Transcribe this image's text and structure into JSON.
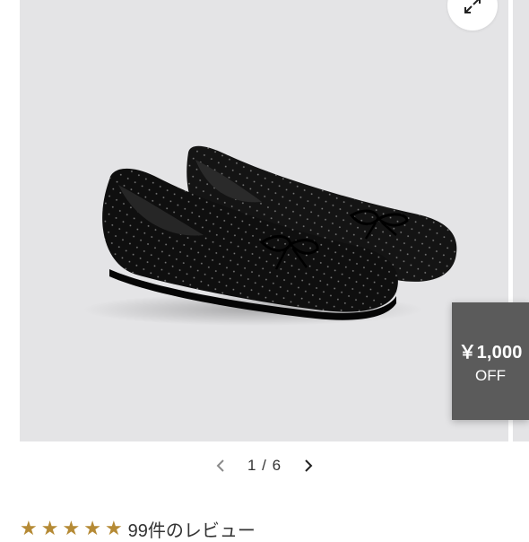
{
  "gallery": {
    "image_alt": "Black knit ballet flats with bow",
    "expand_icon": "expand-arrows-icon"
  },
  "badge": {
    "amount": "￥1,000",
    "label": "OFF"
  },
  "pager": {
    "prev_icon": "chevron-left-icon",
    "next_icon": "chevron-right-icon",
    "counter": "1 / 6"
  },
  "rating": {
    "stars": 5,
    "review_text": "99件のレビュー"
  },
  "colors": {
    "gallery_bg": "#e4e4e6",
    "badge_bg": "#5b5b5b",
    "star": "#b58a35"
  }
}
